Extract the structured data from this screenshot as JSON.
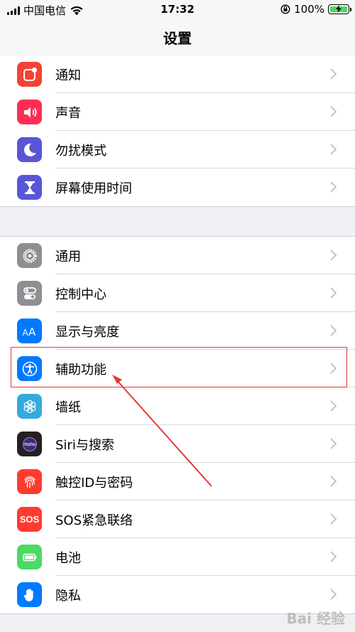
{
  "status": {
    "carrier": "中国电信",
    "time": "17:32",
    "battery": "100%"
  },
  "nav": {
    "title": "设置"
  },
  "groups": [
    {
      "items": [
        {
          "label": "通知",
          "icon": "notifications-icon",
          "color": "#f44336"
        },
        {
          "label": "声音",
          "icon": "sounds-icon",
          "color": "#ff2d55"
        },
        {
          "label": "勿扰模式",
          "icon": "do-not-disturb-icon",
          "color": "#5856d6"
        },
        {
          "label": "屏幕使用时间",
          "icon": "screen-time-icon",
          "color": "#5856d6"
        }
      ]
    },
    {
      "items": [
        {
          "label": "通用",
          "icon": "gear-icon",
          "color": "#8e8e93"
        },
        {
          "label": "控制中心",
          "icon": "control-center-icon",
          "color": "#8e8e93"
        },
        {
          "label": "显示与亮度",
          "icon": "display-brightness-icon",
          "color": "#007aff"
        },
        {
          "label": "辅助功能",
          "icon": "accessibility-icon",
          "color": "#007aff"
        },
        {
          "label": "墙纸",
          "icon": "wallpaper-icon",
          "color": "#34aadc"
        },
        {
          "label": "Siri与搜索",
          "icon": "siri-icon",
          "color": "#222222"
        },
        {
          "label": "触控ID与密码",
          "icon": "fingerprint-icon",
          "color": "#ff3b30"
        },
        {
          "label": "SOS紧急联络",
          "icon": "sos-icon",
          "color": "#ff3b30",
          "icon_text": "SOS"
        },
        {
          "label": "电池",
          "icon": "battery-icon",
          "color": "#4cd964"
        },
        {
          "label": "隐私",
          "icon": "privacy-hand-icon",
          "color": "#007aff"
        }
      ]
    }
  ],
  "watermark": "Bai 经验"
}
